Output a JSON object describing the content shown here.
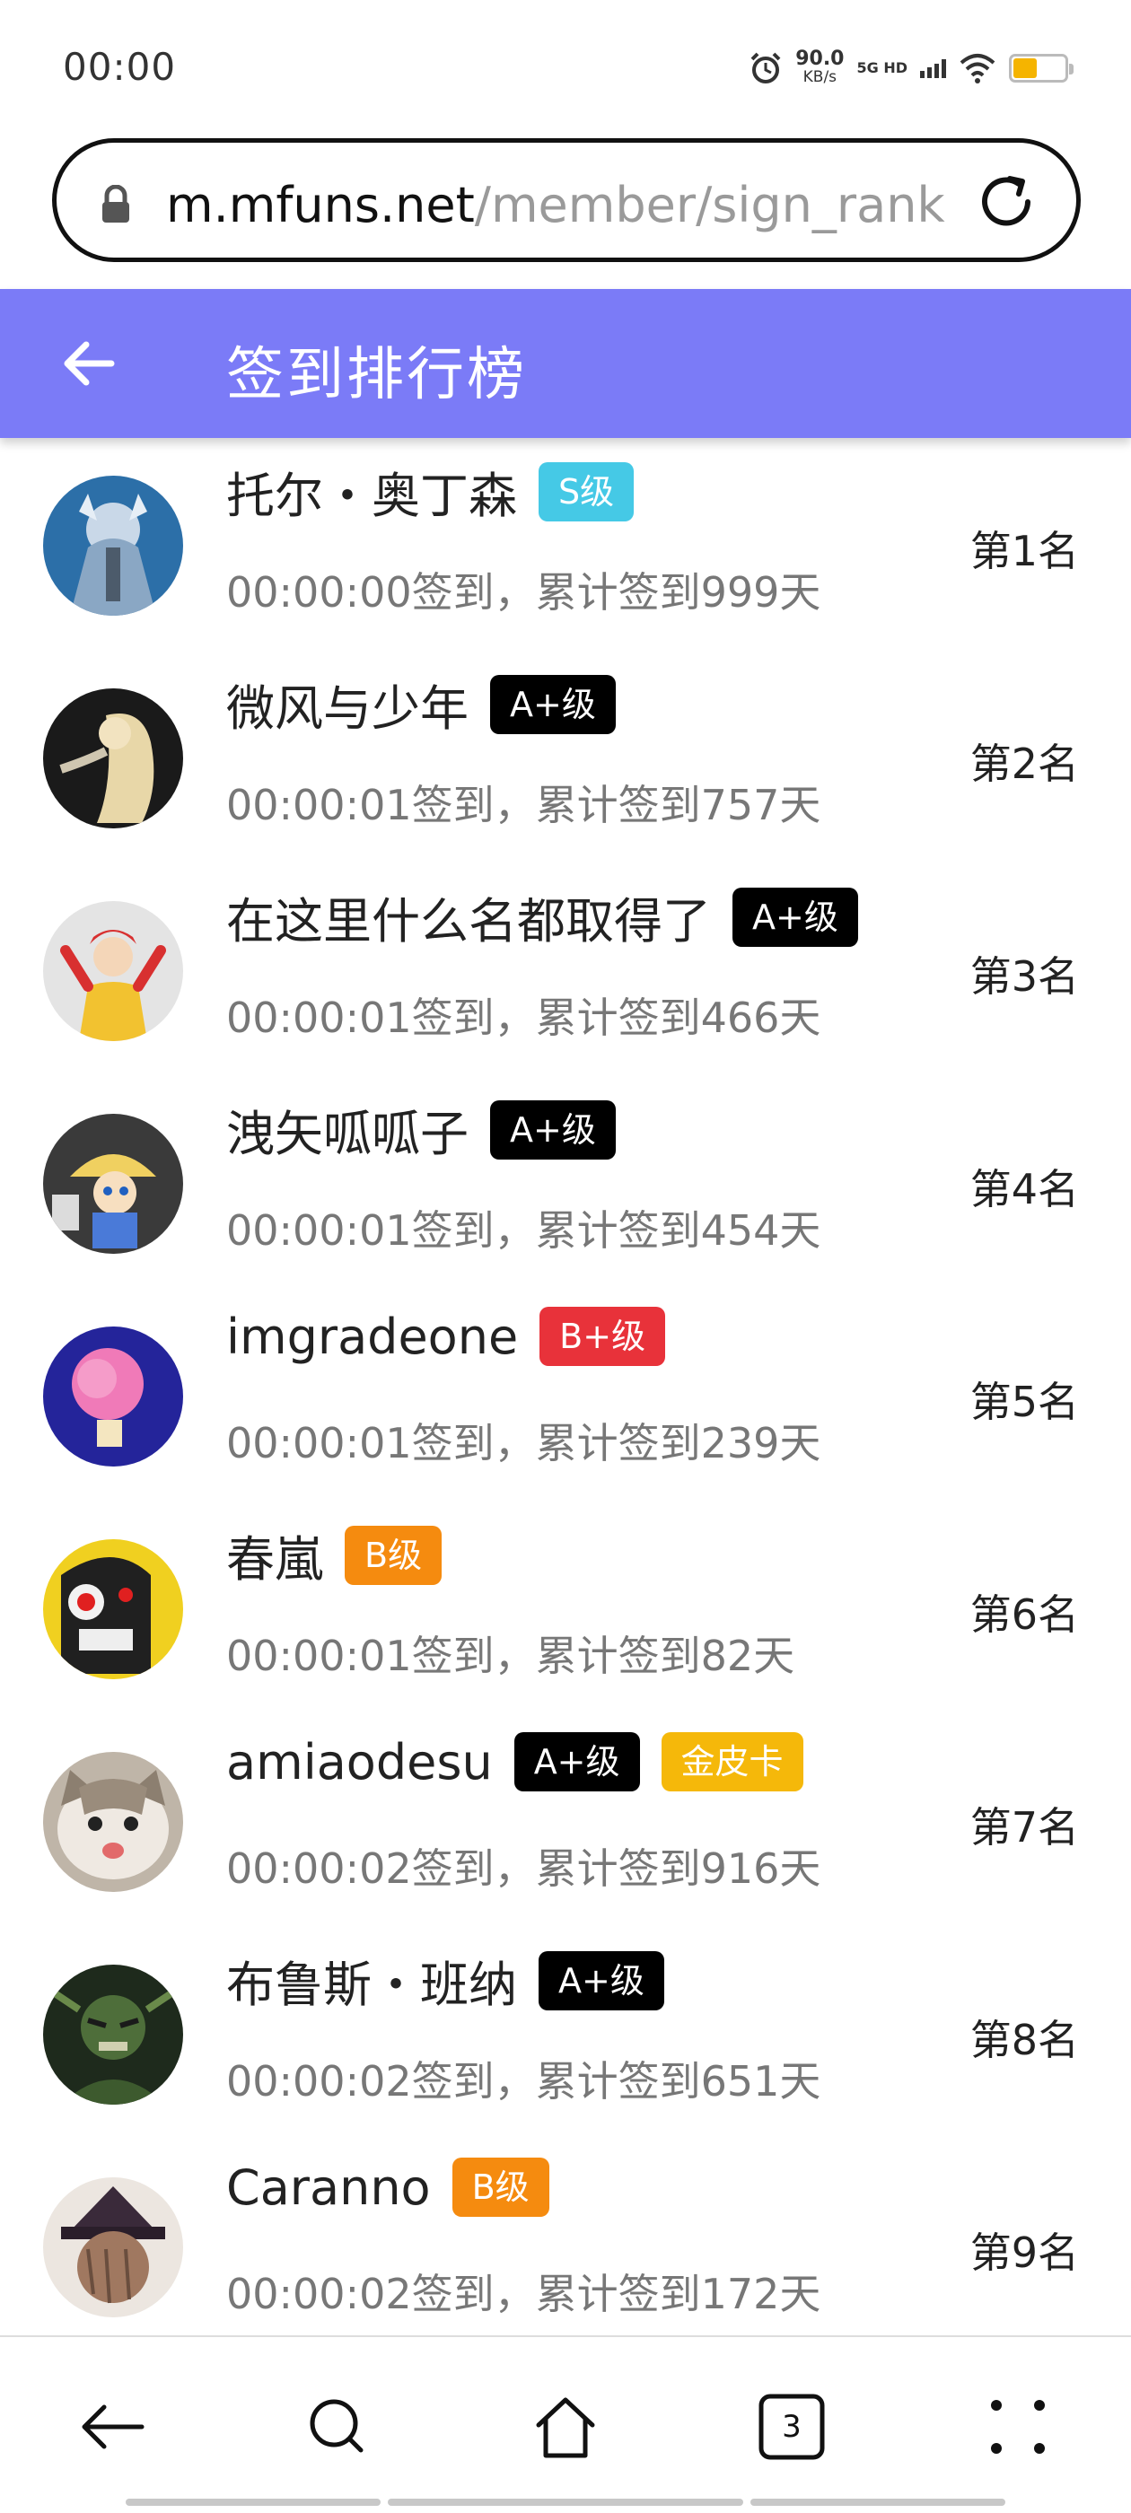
{
  "status_bar": {
    "time": "00:00",
    "speed_value": "90.0",
    "speed_unit": "KB/s",
    "network": "5G HD",
    "battery_level": 0.44
  },
  "browser": {
    "url_host": "m.mfuns.net",
    "url_path": "/member/sign_rank",
    "tab_count": "3"
  },
  "header": {
    "title": "签到排行榜"
  },
  "ranks": [
    {
      "name": "托尔・奥丁森",
      "badges": [
        {
          "label": "S级",
          "color": "#45c9e6"
        }
      ],
      "sign_info": "00:00:00签到，累计签到999天",
      "rank": "第1名"
    },
    {
      "name": "微风与少年",
      "badges": [
        {
          "label": "A+级",
          "color": "#000000"
        }
      ],
      "sign_info": "00:00:01签到，累计签到757天",
      "rank": "第2名"
    },
    {
      "name": "在这里什么名都取得了",
      "badges": [
        {
          "label": "A+级",
          "color": "#000000"
        }
      ],
      "sign_info": "00:00:01签到，累计签到466天",
      "rank": "第3名"
    },
    {
      "name": "洩矢呱呱子",
      "badges": [
        {
          "label": "A+级",
          "color": "#000000"
        }
      ],
      "sign_info": "00:00:01签到，累计签到454天",
      "rank": "第4名"
    },
    {
      "name": "imgradeone",
      "badges": [
        {
          "label": "B+级",
          "color": "#e8323a"
        }
      ],
      "sign_info": "00:00:01签到，累计签到239天",
      "rank": "第5名"
    },
    {
      "name": "春嵐",
      "badges": [
        {
          "label": "B级",
          "color": "#f58b0f"
        }
      ],
      "sign_info": "00:00:01签到，累计签到82天",
      "rank": "第6名"
    },
    {
      "name": "amiaodesu",
      "badges": [
        {
          "label": "A+级",
          "color": "#000000"
        },
        {
          "label": "金皮卡",
          "color": "#f5b80a"
        }
      ],
      "sign_info": "00:00:02签到，累计签到916天",
      "rank": "第7名"
    },
    {
      "name": "布鲁斯・班纳",
      "badges": [
        {
          "label": "A+级",
          "color": "#000000"
        }
      ],
      "sign_info": "00:00:02签到，累计签到651天",
      "rank": "第8名"
    },
    {
      "name": "Caranno",
      "badges": [
        {
          "label": "B级",
          "color": "#f58b0f"
        }
      ],
      "sign_info": "00:00:02签到，累计签到172天",
      "rank": "第9名"
    }
  ]
}
